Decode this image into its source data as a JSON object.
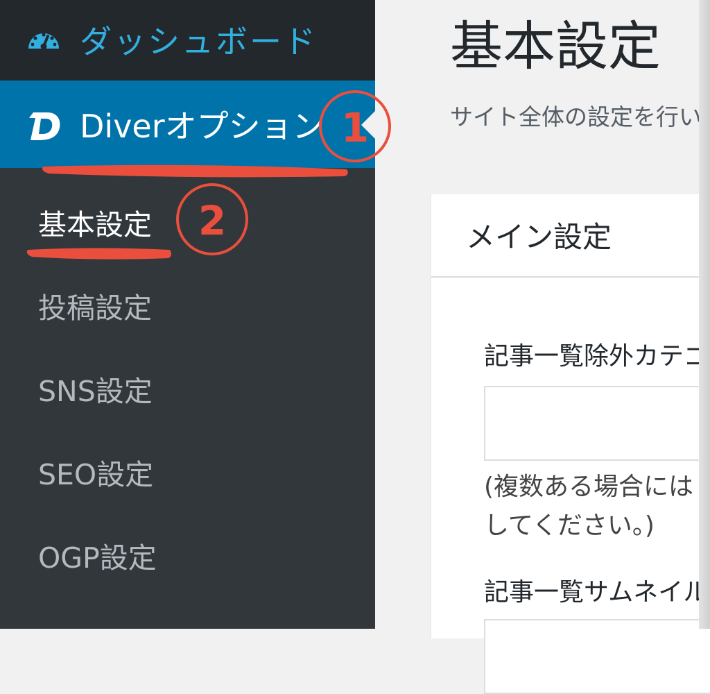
{
  "sidebar": {
    "dashboard_label": "ダッシュボード",
    "diver_label": "Diverオプション",
    "submenu": [
      {
        "label": "基本設定",
        "current": true
      },
      {
        "label": "投稿設定"
      },
      {
        "label": "SNS設定"
      },
      {
        "label": "SEO設定"
      },
      {
        "label": "OGP設定"
      }
    ]
  },
  "annotations": {
    "marker_1": "1",
    "marker_2": "2",
    "color": "#ea4f3d"
  },
  "main": {
    "title": "基本設定",
    "description": "サイト全体の設定を行い",
    "card_title": "メイン設定",
    "field1_label": "記事一覧除外カテゴ",
    "field1_value": "",
    "field1_help_line1": "(複数ある場合には",
    "field1_help_line2": "してください。)",
    "field2_label": "記事一覧サムネイル"
  },
  "colors": {
    "sidebar_bg": "#32373c",
    "dashboard_bg": "#23282d",
    "active_bg": "#0073aa",
    "dashboard_text": "#31b0e0",
    "submenu_text": "#b4b9be"
  }
}
